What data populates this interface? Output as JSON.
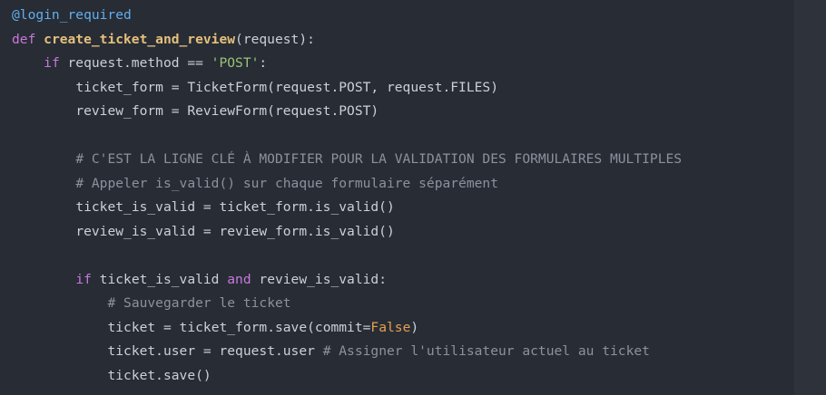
{
  "colors": {
    "background": "#282c34",
    "right_strip": "#2e323a",
    "plain": "#c9d1d9",
    "decorator": "#61afef",
    "keyword": "#c678dd",
    "function_name": "#e5c07b",
    "string": "#98c379",
    "comment": "#8b929e",
    "constant": "#e5a050"
  },
  "code": {
    "language": "python",
    "lines": [
      {
        "indent": 0,
        "tokens": [
          {
            "kind": "deco",
            "text": "@login_required"
          }
        ]
      },
      {
        "indent": 0,
        "tokens": [
          {
            "kind": "keyword",
            "text": "def"
          },
          {
            "kind": "plain",
            "text": " "
          },
          {
            "kind": "func",
            "text": "create_ticket_and_review"
          },
          {
            "kind": "plain",
            "text": "(request):"
          }
        ]
      },
      {
        "indent": 4,
        "tokens": [
          {
            "kind": "keyword",
            "text": "if"
          },
          {
            "kind": "plain",
            "text": " request.method == "
          },
          {
            "kind": "string",
            "text": "'POST'"
          },
          {
            "kind": "plain",
            "text": ":"
          }
        ]
      },
      {
        "indent": 8,
        "tokens": [
          {
            "kind": "plain",
            "text": "ticket_form = TicketForm(request.POST, request.FILES)"
          }
        ]
      },
      {
        "indent": 8,
        "tokens": [
          {
            "kind": "plain",
            "text": "review_form = ReviewForm(request.POST)"
          }
        ]
      },
      {
        "indent": 0,
        "tokens": []
      },
      {
        "indent": 8,
        "tokens": [
          {
            "kind": "comment",
            "text": "# C'EST LA LIGNE CLÉ À MODIFIER POUR LA VALIDATION DES FORMULAIRES MULTIPLES"
          }
        ]
      },
      {
        "indent": 8,
        "tokens": [
          {
            "kind": "comment",
            "text": "# Appeler is_valid() sur chaque formulaire séparément"
          }
        ]
      },
      {
        "indent": 8,
        "tokens": [
          {
            "kind": "plain",
            "text": "ticket_is_valid = ticket_form.is_valid()"
          }
        ]
      },
      {
        "indent": 8,
        "tokens": [
          {
            "kind": "plain",
            "text": "review_is_valid = review_form.is_valid()"
          }
        ]
      },
      {
        "indent": 0,
        "tokens": []
      },
      {
        "indent": 8,
        "tokens": [
          {
            "kind": "keyword",
            "text": "if"
          },
          {
            "kind": "plain",
            "text": " ticket_is_valid "
          },
          {
            "kind": "keyword",
            "text": "and"
          },
          {
            "kind": "plain",
            "text": " review_is_valid:"
          }
        ]
      },
      {
        "indent": 12,
        "tokens": [
          {
            "kind": "comment",
            "text": "# Sauvegarder le ticket"
          }
        ]
      },
      {
        "indent": 12,
        "tokens": [
          {
            "kind": "plain",
            "text": "ticket = ticket_form.save(commit="
          },
          {
            "kind": "const",
            "text": "False"
          },
          {
            "kind": "plain",
            "text": ")"
          }
        ]
      },
      {
        "indent": 12,
        "tokens": [
          {
            "kind": "plain",
            "text": "ticket.user = request.user "
          },
          {
            "kind": "comment",
            "text": "# Assigner l'utilisateur actuel au ticket"
          }
        ]
      },
      {
        "indent": 12,
        "tokens": [
          {
            "kind": "plain",
            "text": "ticket.save()"
          }
        ]
      }
    ]
  }
}
